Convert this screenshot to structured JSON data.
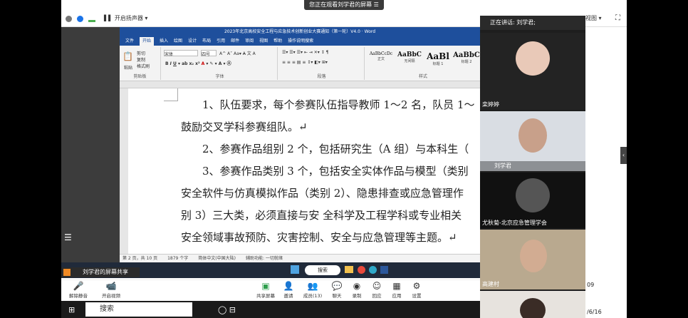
{
  "banner": {
    "text": "您正在观看刘学君的屏幕"
  },
  "topbar": {
    "speaker_btn": "开启扬声器",
    "view_btn": "视图"
  },
  "word": {
    "title": "2023年北京高校安全工程与应急技术创新创业大赛通知（第一轮）V4.0 · Word",
    "tabs": [
      "文件",
      "开始",
      "插入",
      "绘图",
      "设计",
      "布局",
      "引用",
      "邮件",
      "审阅",
      "视图",
      "帮助",
      "操作说明搜索"
    ],
    "clipboard": {
      "paste": "粘贴",
      "cut": "剪切",
      "copy": "复制",
      "format_painter": "格式刷",
      "label": "剪贴板"
    },
    "font": {
      "name": "宋体",
      "size": "四号",
      "label": "字体"
    },
    "paragraph_label": "段落",
    "styles": {
      "label": "样式",
      "items": [
        {
          "preview": "AaBbCcDc",
          "name": "正文"
        },
        {
          "preview": "AaBbC",
          "name": "无间隔"
        },
        {
          "preview": "AaBl",
          "name": "标题 1"
        },
        {
          "preview": "AaBbC",
          "name": "标题 2"
        }
      ]
    },
    "doc_lines": [
      "　　1、队伍要求，每个参赛队伍指导教师 1～2 名，队员 1～",
      "鼓励交叉学科参赛组队。↵",
      "　　2、参赛作品组别 2 个，包括研究生（A 组）与本科生（",
      "　　3、参赛作品类别 3 个，包括安全实体作品与模型（类别",
      "安全软件与仿真模拟作品（类别 2）、隐患排查或应急管理作",
      "别 3）三大类，必须直接与安 全科学及工程学科或专业相关",
      "安全领域事故预防、灾害控制、安全与应急管理等主题。↵"
    ],
    "status": {
      "page": "第 2 页，共 10 页",
      "words": "1879 个字",
      "lang": "简体中文(中国大陆)",
      "access": "辅助功能: 一切就绪"
    }
  },
  "share_label": "刘学君的屏幕共享",
  "taskbar_search": "搜索",
  "controls": [
    {
      "icon": "mic-icon",
      "label": "解除静音"
    },
    {
      "icon": "video-icon",
      "label": "开启视频"
    },
    {
      "icon": "share-screen-icon",
      "label": "共享屏幕"
    },
    {
      "icon": "invite-icon",
      "label": "邀请"
    },
    {
      "icon": "members-icon",
      "label": "成员(13)"
    },
    {
      "icon": "chat-icon",
      "label": "聊天"
    },
    {
      "icon": "record-icon",
      "label": "录制"
    },
    {
      "icon": "rooms-icon",
      "label": "回应"
    },
    {
      "icon": "apps-icon",
      "label": "应用"
    },
    {
      "icon": "settings-icon",
      "label": "设置"
    }
  ],
  "windows_search": "搜索",
  "speaking": "正在讲话: 刘学君;",
  "participants": [
    {
      "name": "栾婷婷"
    },
    {
      "name": "刘学君"
    },
    {
      "name": "尤秋菊-北京应急管理学会"
    },
    {
      "name": "高建村"
    }
  ],
  "clock": {
    "time": "09",
    "date": "/6/16"
  }
}
